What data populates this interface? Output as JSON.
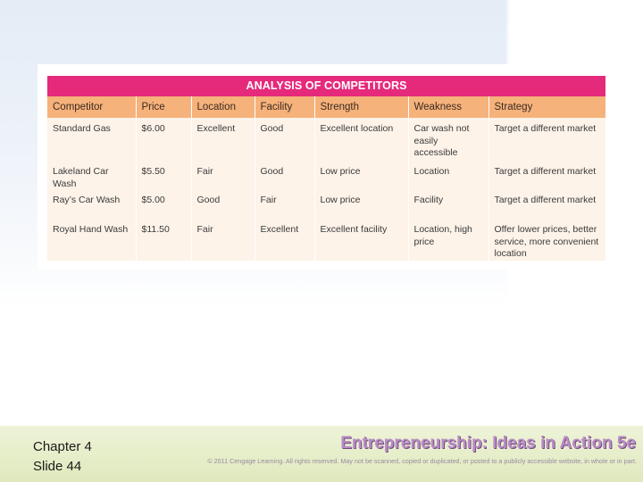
{
  "table": {
    "title": "ANALYSIS OF COMPETITORS",
    "headers": [
      "Competitor",
      "Price",
      "Location",
      "Facility",
      "Strength",
      "Weakness",
      "Strategy"
    ],
    "rows": [
      [
        "Standard Gas",
        "$6.00",
        "Excellent",
        "Good",
        "Excellent location",
        "Car wash not easily accessible",
        "Target a different market"
      ],
      [
        "Lakeland Car Wash",
        "$5.50",
        "Fair",
        "Good",
        "Low price",
        "Location",
        "Target a different market"
      ],
      [
        "Ray’s Car Wash",
        "$5.00",
        "Good",
        "Fair",
        "Low price",
        "Facility",
        "Target a different market"
      ],
      [
        "Royal Hand Wash",
        "$11.50",
        "Fair",
        "Excellent",
        "Excellent facility",
        "Location, high price",
        "Offer lower prices, better service, more convenient location"
      ]
    ]
  },
  "footer": {
    "chapter": "Chapter 4",
    "slide": "Slide 44",
    "book_title": "Entrepreneurship: Ideas in Action 5e",
    "copyright": "© 2011 Cengage Learning. All rights reserved. May not be scanned, copied or duplicated, or posted to a publicly accessible website, in whole or in part."
  },
  "colors": {
    "title_bar": "#e52a7c",
    "header_row": "#f6b27b",
    "body_bg": "#fdf3e9",
    "footer_bg": "#dfe9bd",
    "book_title": "#b98cc6"
  }
}
